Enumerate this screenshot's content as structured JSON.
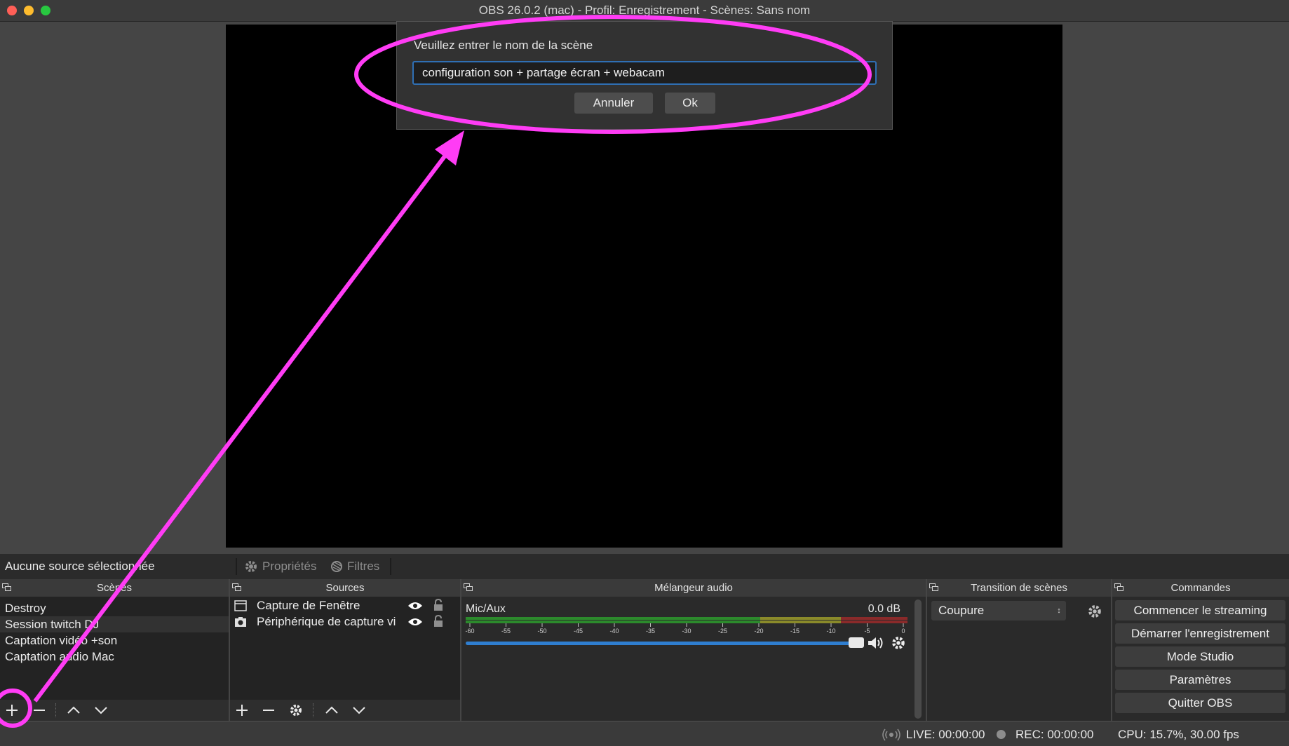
{
  "window": {
    "title": "OBS 26.0.2 (mac) - Profil: Enregistrement - Scènes: Sans nom"
  },
  "dialog": {
    "prompt": "Veuillez entrer le nom de la scène",
    "input_value": "configuration son + partage écran + webacam",
    "cancel_label": "Annuler",
    "ok_label": "Ok"
  },
  "source_toolbar": {
    "no_source": "Aucune source sélectionnée",
    "properties": "Propriétés",
    "filters": "Filtres"
  },
  "scenes": {
    "title": "Scènes",
    "items": [
      "Destroy",
      "Session twitch DJ",
      "Captation vidéo +son",
      "Captation audio Mac"
    ]
  },
  "sources": {
    "title": "Sources",
    "items": [
      "Capture de Fenêtre",
      "Périphérique de capture vi"
    ]
  },
  "mixer": {
    "title": "Mélangeur audio",
    "channel": "Mic/Aux",
    "level": "0.0 dB",
    "ticks": [
      "-60",
      "-55",
      "-50",
      "-45",
      "-40",
      "-35",
      "-30",
      "-25",
      "-20",
      "-15",
      "-10",
      "-5",
      "0"
    ],
    "volume_fraction": 0.92
  },
  "transition": {
    "title": "Transition de scènes",
    "selected": "Coupure"
  },
  "commands": {
    "title": "Commandes",
    "start_stream": "Commencer le streaming",
    "start_record": "Démarrer l'enregistrement",
    "studio_mode": "Mode Studio",
    "settings": "Paramètres",
    "quit": "Quitter OBS"
  },
  "status": {
    "live": "LIVE: 00:00:00",
    "rec": "REC: 00:00:00",
    "cpu": "CPU: 15.7%, 30.00 fps"
  },
  "colors": {
    "annotation": "#ff3cf5",
    "accent": "#2f7ed0"
  },
  "icons": [
    "plus-icon",
    "minus-icon",
    "chevron-up-icon",
    "chevron-down-icon",
    "gear-icon",
    "eye-icon",
    "lock-icon",
    "speaker-icon",
    "window-icon",
    "camera-icon",
    "broadcast-icon",
    "filters-icon",
    "float-icon"
  ]
}
